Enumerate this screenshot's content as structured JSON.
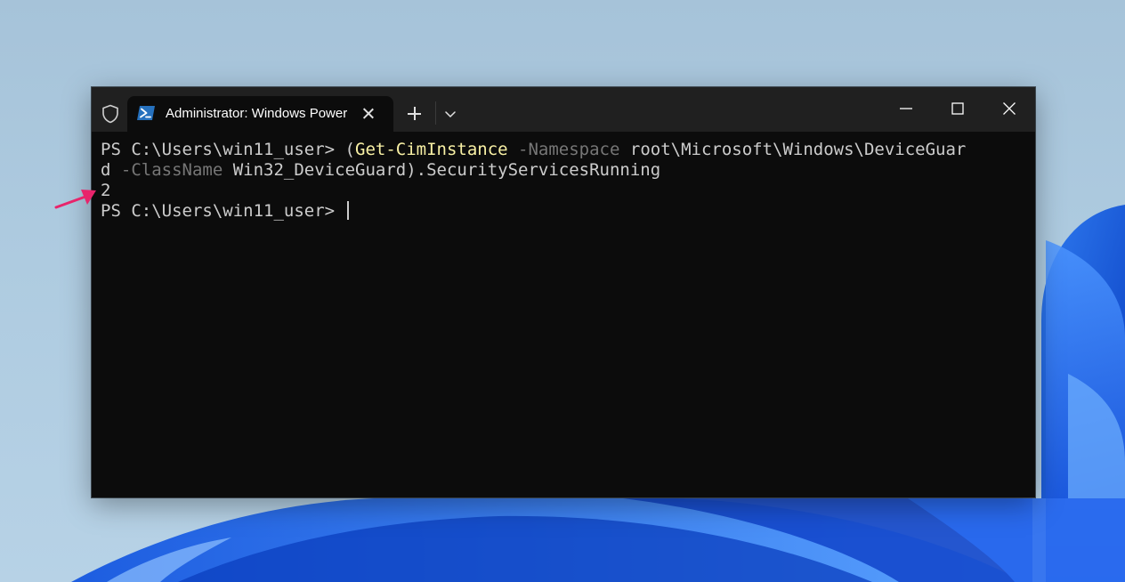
{
  "window": {
    "tab_title": "Administrator: Windows PowerShell"
  },
  "terminal": {
    "line1": {
      "prompt": "PS C:\\Users\\win11_user> ",
      "paren_open": "(",
      "cmdlet": "Get-CimInstance",
      "param1": " -Namespace",
      "arg1": " root\\Microsoft\\Windows\\DeviceGuar"
    },
    "line2": {
      "arg1_cont": "d",
      "param2": " -ClassName",
      "arg2": " Win32_DeviceGuard",
      "tail": ").SecurityServicesRunning"
    },
    "output": "2",
    "line4": {
      "prompt": "PS C:\\Users\\win11_user> "
    }
  },
  "colors": {
    "annotation_arrow": "#e8246b",
    "terminal_bg": "#0c0c0c",
    "titlebar_bg": "#202020",
    "cmdlet": "#f9f1a5",
    "parameter": "#767676",
    "text": "#cccccc"
  },
  "icons": {
    "titlebar_shield": "shield-icon",
    "tab": "powershell-icon",
    "tab_close": "close-icon",
    "new_tab": "plus-icon",
    "dropdown": "chevron-down-icon",
    "minimize": "minimize-icon",
    "maximize": "maximize-icon",
    "close": "close-icon"
  }
}
